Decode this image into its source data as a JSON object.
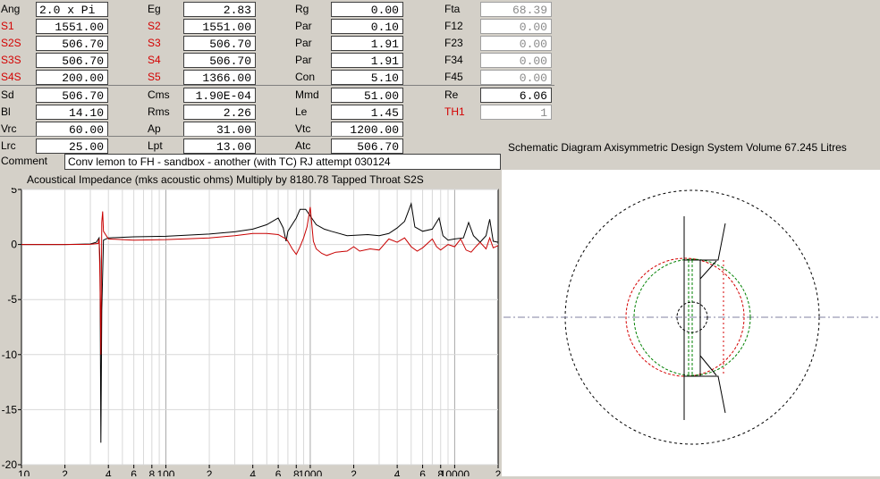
{
  "params": {
    "c1": [
      {
        "label": "Ang",
        "value": "2.0 x Pi",
        "red": false,
        "disabled": false,
        "align": "left"
      },
      {
        "label": "S1",
        "value": "1551.00",
        "red": true,
        "disabled": false
      },
      {
        "label": "S2S",
        "value": "506.70",
        "red": true,
        "disabled": false
      },
      {
        "label": "S3S",
        "value": "506.70",
        "red": true,
        "disabled": false
      },
      {
        "label": "S4S",
        "value": "200.00",
        "red": true,
        "disabled": false
      },
      {
        "label": "Sd",
        "value": "506.70",
        "red": false,
        "disabled": false
      },
      {
        "label": "Bl",
        "value": "14.10",
        "red": false,
        "disabled": false
      },
      {
        "label": "Vrc",
        "value": "60.00",
        "red": false,
        "disabled": false
      },
      {
        "label": "Lrc",
        "value": "25.00",
        "red": false,
        "disabled": false
      }
    ],
    "c2": [
      {
        "label": "Eg",
        "value": "2.83",
        "red": false,
        "disabled": false
      },
      {
        "label": "S2",
        "value": "1551.00",
        "red": true,
        "disabled": false
      },
      {
        "label": "S3",
        "value": "506.70",
        "red": true,
        "disabled": false
      },
      {
        "label": "S4",
        "value": "506.70",
        "red": true,
        "disabled": false
      },
      {
        "label": "S5",
        "value": "1366.00",
        "red": true,
        "disabled": false
      },
      {
        "label": "Cms",
        "value": "1.90E-04",
        "red": false,
        "disabled": false
      },
      {
        "label": "Rms",
        "value": "2.26",
        "red": false,
        "disabled": false
      },
      {
        "label": "Ap",
        "value": "31.00",
        "red": false,
        "disabled": false
      },
      {
        "label": "Lpt",
        "value": "13.00",
        "red": false,
        "disabled": false
      }
    ],
    "c3": [
      {
        "label": "Rg",
        "value": "0.00",
        "red": false,
        "disabled": false
      },
      {
        "label": "Par",
        "value": "0.10",
        "red": false,
        "disabled": false
      },
      {
        "label": "Par",
        "value": "1.91",
        "red": false,
        "disabled": false
      },
      {
        "label": "Par",
        "value": "1.91",
        "red": false,
        "disabled": false
      },
      {
        "label": "Con",
        "value": "5.10",
        "red": false,
        "disabled": false
      },
      {
        "label": "Mmd",
        "value": "51.00",
        "red": false,
        "disabled": false
      },
      {
        "label": "Le",
        "value": "1.45",
        "red": false,
        "disabled": false
      },
      {
        "label": "Vtc",
        "value": "1200.00",
        "red": false,
        "disabled": false
      },
      {
        "label": "Atc",
        "value": "506.70",
        "red": false,
        "disabled": false
      }
    ],
    "c4": [
      {
        "label": "Fta",
        "value": "68.39",
        "red": false,
        "disabled": true
      },
      {
        "label": "F12",
        "value": "0.00",
        "red": false,
        "disabled": true
      },
      {
        "label": "F23",
        "value": "0.00",
        "red": false,
        "disabled": true
      },
      {
        "label": "F34",
        "value": "0.00",
        "red": false,
        "disabled": true
      },
      {
        "label": "F45",
        "value": "0.00",
        "red": false,
        "disabled": true
      },
      {
        "label": "Re",
        "value": "6.06",
        "red": false,
        "disabled": false
      },
      {
        "label": "TH1",
        "value": "1",
        "red": true,
        "disabled": true
      }
    ]
  },
  "comment": {
    "label": "Comment",
    "value": "Conv lemon to FH - sandbox - another (with TC)  RJ attempt 030124"
  },
  "chart": {
    "title": "Acoustical Impedance (mks acoustic ohms)   Multiply by 8180.78   Tapped Throat S2S"
  },
  "schematic": {
    "title": "Schematic Diagram   Axisymmetric Design   System Volume 67.245 Litres"
  },
  "chart_data": {
    "type": "line",
    "title": "Acoustical Impedance (mks acoustic ohms)   Multiply by 8180.78   Tapped Throat S2S",
    "xscale": "log",
    "xlim": [
      10,
      20000
    ],
    "ylim": [
      -20,
      5
    ],
    "yticks": [
      5,
      0,
      -5,
      -10,
      -15,
      -20
    ],
    "ytick_labels": [
      "5",
      "0",
      "-5",
      "-10",
      "-15",
      "-20"
    ],
    "xtick_labels": [
      {
        "v": 10,
        "t": "10"
      },
      {
        "v": 20,
        "t": "2"
      },
      {
        "v": 40,
        "t": "4"
      },
      {
        "v": 60,
        "t": "6"
      },
      {
        "v": 80,
        "t": "8"
      },
      {
        "v": 100,
        "t": "100"
      },
      {
        "v": 200,
        "t": "2"
      },
      {
        "v": 400,
        "t": "4"
      },
      {
        "v": 600,
        "t": "6"
      },
      {
        "v": 800,
        "t": "8"
      },
      {
        "v": 1000,
        "t": "1000"
      },
      {
        "v": 2000,
        "t": "2"
      },
      {
        "v": 4000,
        "t": "4"
      },
      {
        "v": 6000,
        "t": "6"
      },
      {
        "v": 8000,
        "t": "8"
      },
      {
        "v": 10000,
        "t": "10000"
      },
      {
        "v": 20000,
        "t": "2"
      }
    ],
    "grid": true,
    "series": [
      {
        "color": "#000000",
        "points": [
          [
            10,
            0
          ],
          [
            20,
            0
          ],
          [
            30,
            0.05
          ],
          [
            33,
            0.2
          ],
          [
            34.5,
            0.6
          ],
          [
            35,
            -1.5
          ],
          [
            35.5,
            -18
          ],
          [
            36,
            -6
          ],
          [
            37,
            0.4
          ],
          [
            40,
            0.6
          ],
          [
            60,
            0.7
          ],
          [
            100,
            0.75
          ],
          [
            200,
            0.95
          ],
          [
            300,
            1.15
          ],
          [
            400,
            1.4
          ],
          [
            500,
            1.8
          ],
          [
            600,
            2.4
          ],
          [
            650,
            1.5
          ],
          [
            680,
            0.3
          ],
          [
            700,
            1.2
          ],
          [
            800,
            2.4
          ],
          [
            850,
            3.2
          ],
          [
            930,
            3.2
          ],
          [
            1000,
            2.6
          ],
          [
            1100,
            1.8
          ],
          [
            1250,
            1.4
          ],
          [
            1400,
            1.2
          ],
          [
            1800,
            0.8
          ],
          [
            2500,
            0.9
          ],
          [
            3000,
            0.8
          ],
          [
            3500,
            1.0
          ],
          [
            4000,
            1.5
          ],
          [
            4500,
            2.1
          ],
          [
            5000,
            3.7
          ],
          [
            5300,
            1.6
          ],
          [
            6000,
            1.2
          ],
          [
            7000,
            1.4
          ],
          [
            7800,
            2.4
          ],
          [
            8300,
            0.8
          ],
          [
            9000,
            0.4
          ],
          [
            10000,
            0.5
          ],
          [
            11500,
            0.6
          ],
          [
            12500,
            2.0
          ],
          [
            13500,
            0.8
          ],
          [
            15000,
            0.2
          ],
          [
            16500,
            0.8
          ],
          [
            17500,
            2.3
          ],
          [
            18500,
            0.3
          ],
          [
            20000,
            0.2
          ]
        ]
      },
      {
        "color": "#c80000",
        "points": [
          [
            10,
            0
          ],
          [
            20,
            0
          ],
          [
            30,
            0.02
          ],
          [
            34,
            0.1
          ],
          [
            34.5,
            0.5
          ],
          [
            35,
            -3
          ],
          [
            35.5,
            -10
          ],
          [
            36,
            2.0
          ],
          [
            36.5,
            3.0
          ],
          [
            37,
            1.2
          ],
          [
            40,
            0.5
          ],
          [
            60,
            0.4
          ],
          [
            100,
            0.45
          ],
          [
            200,
            0.6
          ],
          [
            300,
            0.8
          ],
          [
            400,
            1.0
          ],
          [
            500,
            1.0
          ],
          [
            600,
            0.9
          ],
          [
            680,
            0.5
          ],
          [
            700,
            0.3
          ],
          [
            750,
            -0.4
          ],
          [
            800,
            -0.9
          ],
          [
            850,
            -0.2
          ],
          [
            900,
            0.6
          ],
          [
            950,
            1.6
          ],
          [
            1000,
            3.4
          ],
          [
            1050,
            0.3
          ],
          [
            1100,
            -0.4
          ],
          [
            1200,
            -0.8
          ],
          [
            1300,
            -1.0
          ],
          [
            1500,
            -0.7
          ],
          [
            1800,
            -0.6
          ],
          [
            2000,
            -0.2
          ],
          [
            2200,
            -0.6
          ],
          [
            2600,
            -0.4
          ],
          [
            3000,
            -0.5
          ],
          [
            3500,
            0.5
          ],
          [
            4000,
            0.2
          ],
          [
            4500,
            0.6
          ],
          [
            5000,
            -0.2
          ],
          [
            5500,
            -0.6
          ],
          [
            6000,
            -0.3
          ],
          [
            7000,
            0.5
          ],
          [
            7500,
            -0.2
          ],
          [
            8000,
            -0.5
          ],
          [
            9000,
            0.0
          ],
          [
            10000,
            -0.2
          ],
          [
            11000,
            0.5
          ],
          [
            12000,
            -0.5
          ],
          [
            13000,
            -0.7
          ],
          [
            14000,
            -0.2
          ],
          [
            15000,
            0.2
          ],
          [
            16500,
            -0.4
          ],
          [
            17500,
            0.6
          ],
          [
            18500,
            -0.3
          ],
          [
            20000,
            -0.1
          ]
        ]
      }
    ]
  }
}
